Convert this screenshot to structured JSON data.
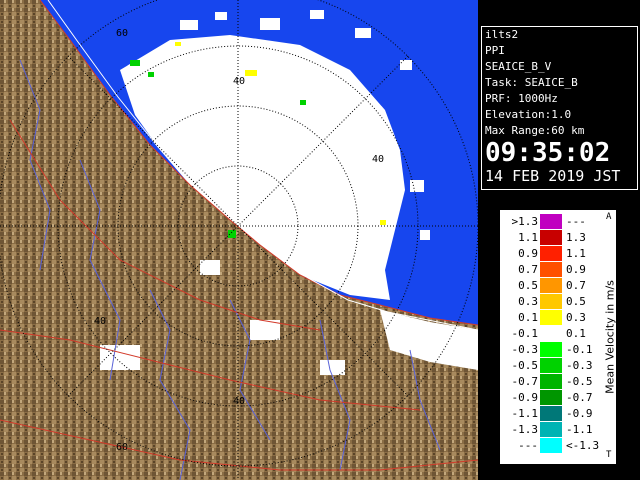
{
  "map": {
    "range_labels": [
      "60",
      "40",
      "40",
      "40",
      "40",
      "60"
    ],
    "colors": {
      "sea": "#1746ee",
      "land": "#8a6d45",
      "echo_white": "#ffffff",
      "rings": "#000000",
      "coast": "#d23a2a",
      "rivers": "#5a63d8"
    }
  },
  "info": {
    "site": "ilts2",
    "mode": "PPI",
    "product": "SEAICE_B_V",
    "task": "Task: SEAICE_B",
    "prf": "PRF: 1000Hz",
    "elevation": "Elevation:1.0",
    "max_range": "Max Range:60 km",
    "time": "09:35:02",
    "date": "14 FEB 2019 JST"
  },
  "legend": {
    "title": "Mean Velocity in m/s",
    "top_marker": "A",
    "bottom_marker": "T",
    "rows": [
      {
        "lo": ">1.3",
        "hi": "---",
        "color": "#c000c0"
      },
      {
        "lo": "1.1",
        "hi": "1.3",
        "color": "#c80000"
      },
      {
        "lo": "0.9",
        "hi": "1.1",
        "color": "#ff2000"
      },
      {
        "lo": "0.7",
        "hi": "0.9",
        "color": "#ff5000"
      },
      {
        "lo": "0.5",
        "hi": "0.7",
        "color": "#ff9600"
      },
      {
        "lo": "0.3",
        "hi": "0.5",
        "color": "#ffc800"
      },
      {
        "lo": "0.1",
        "hi": "0.3",
        "color": "#ffff00"
      },
      {
        "lo": "-0.1",
        "hi": "0.1",
        "color": "#ffffff"
      },
      {
        "lo": "-0.3",
        "hi": "-0.1",
        "color": "#00ff00"
      },
      {
        "lo": "-0.5",
        "hi": "-0.3",
        "color": "#00d200"
      },
      {
        "lo": "-0.7",
        "hi": "-0.5",
        "color": "#00b400"
      },
      {
        "lo": "-0.9",
        "hi": "-0.7",
        "color": "#009600"
      },
      {
        "lo": "-1.1",
        "hi": "-0.9",
        "color": "#007878"
      },
      {
        "lo": "-1.3",
        "hi": "-1.1",
        "color": "#00b4b4"
      },
      {
        "lo": "---",
        "hi": "<-1.3",
        "color": "#00ffff"
      }
    ]
  }
}
